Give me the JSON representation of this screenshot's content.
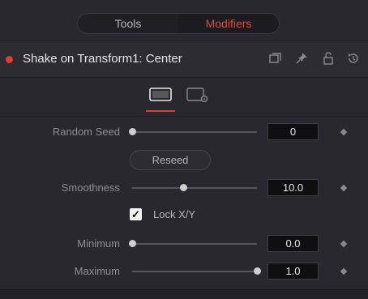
{
  "tabs": [
    {
      "label": "Tools",
      "active": false
    },
    {
      "label": "Modifiers",
      "active": true
    }
  ],
  "header": {
    "title": "Shake on Transform1: Center",
    "icons": [
      "collapse-panel-icon",
      "pin-icon",
      "lock-icon",
      "reset-icon"
    ]
  },
  "subtabs": [
    {
      "icon": "controls-tab-icon",
      "active": true
    },
    {
      "icon": "settings-tab-icon",
      "active": false
    }
  ],
  "controls": {
    "random_seed": {
      "label": "Random Seed",
      "value": "0",
      "fraction": 0.0
    },
    "reseed_label": "Reseed",
    "smoothness": {
      "label": "Smoothness",
      "value": "10.0",
      "fraction": 0.41
    },
    "lock": {
      "label": "Lock X/Y",
      "checked": true
    },
    "minimum": {
      "label": "Minimum",
      "value": "0.0",
      "fraction": 0.0
    },
    "maximum": {
      "label": "Maximum",
      "value": "1.0",
      "fraction": 1.0
    }
  },
  "colors": {
    "accent": "#e63b2e",
    "background": "#28282e",
    "field_bg": "#0f0f12"
  }
}
